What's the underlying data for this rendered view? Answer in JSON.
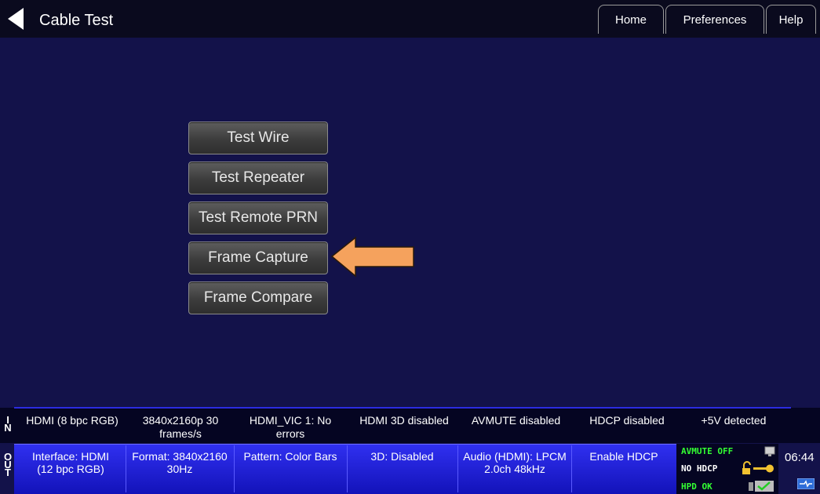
{
  "header": {
    "title": "Cable Test",
    "nav": [
      "Home",
      "Preferences",
      "Help"
    ]
  },
  "menu": {
    "buttons": [
      "Test Wire",
      "Test Repeater",
      "Test Remote PRN",
      "Frame Capture",
      "Frame Compare"
    ],
    "highlighted": "Frame Capture",
    "highlight_color": "#f5a25d"
  },
  "input_status": {
    "label": "IN",
    "cells": [
      "HDMI (8 bpc RGB)",
      "3840x2160p 30 frames/s",
      "HDMI_VIC 1: No errors",
      "HDMI 3D disabled",
      "AVMUTE disabled",
      "HDCP disabled",
      "+5V detected"
    ]
  },
  "output_status": {
    "label": "OUT",
    "cells": [
      "Interface: HDMI (12 bpc RGB)",
      "Format: 3840x2160 30Hz",
      "Pattern: Color Bars",
      "3D: Disabled",
      "Audio (HDMI): LPCM 2.0ch 48kHz",
      "Enable HDCP"
    ]
  },
  "indicators": {
    "avmute": "AVMUTE OFF",
    "hdcp": "NO HDCP",
    "hpd": "HPD OK",
    "time": "06:44"
  },
  "colors": {
    "background": "#13124a",
    "out_bar": "#2020d8",
    "indicator_green": "#33ff33"
  }
}
